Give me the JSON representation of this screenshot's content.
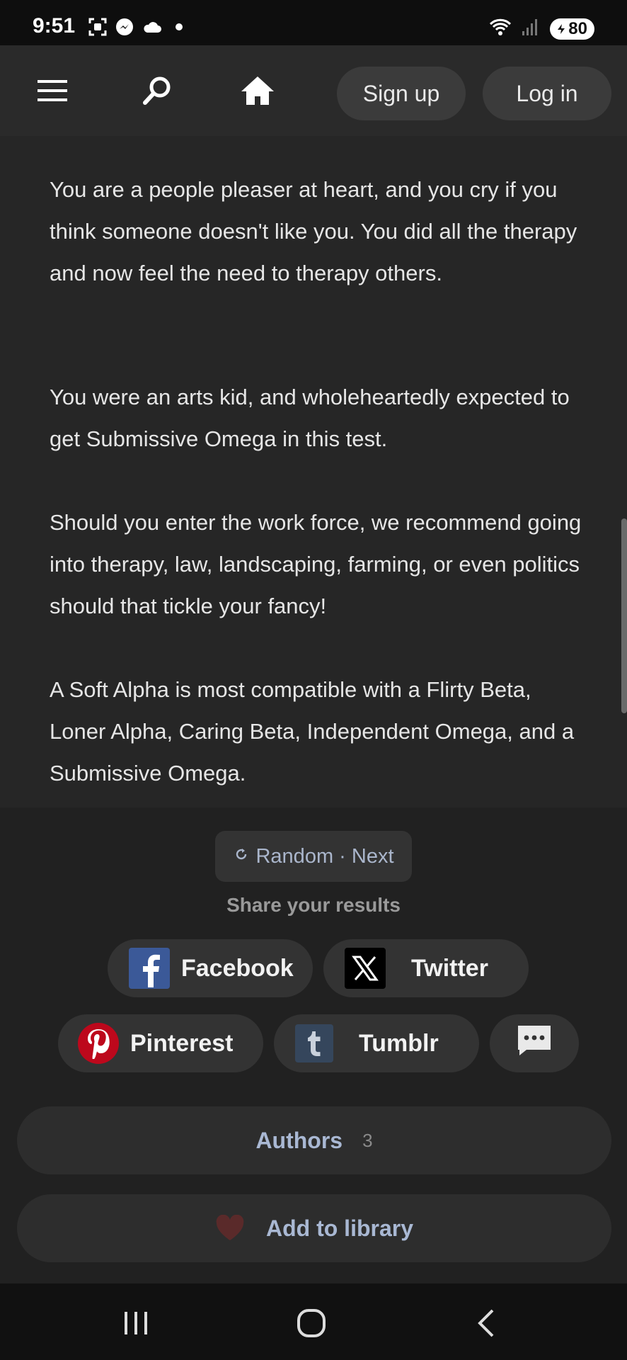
{
  "status_bar": {
    "time": "9:51",
    "battery": "80",
    "icons": [
      "screenshot-icon",
      "messenger-icon",
      "cloud-icon",
      "dot-icon",
      "wifi-icon",
      "signal-icon",
      "battery-icon"
    ]
  },
  "nav": {
    "signup_label": "Sign up",
    "login_label": "Log in",
    "icons": [
      "menu-icon",
      "search-icon",
      "home-icon"
    ]
  },
  "content": {
    "paragraphs": [
      "You are a people pleaser at heart, and you cry if you think someone doesn't like you. You did all the therapy and now feel the need to therapy others.",
      "You were an arts kid, and wholeheartedly expected to get Submissive Omega in this test.",
      "Should you enter the work force, we recommend going into therapy, law, landscaping, farming, or even politics should that tickle your fancy!",
      "A Soft Alpha is most compatible with a Flirty Beta, Loner Alpha, Caring Beta, Independent Omega, and a Submissive Omega."
    ]
  },
  "actions": {
    "random_label": "Random · Next",
    "share_title": "Share your results",
    "share": {
      "facebook": "Facebook",
      "twitter": "Twitter",
      "pinterest": "Pinterest",
      "tumblr": "Tumblr"
    },
    "authors_label": "Authors",
    "authors_count": "3",
    "library_label": "Add to library"
  },
  "colors": {
    "accent_link": "#aab6cc",
    "facebook": "#3b5998",
    "pinterest": "#bd081c",
    "tumblr": "#35465c",
    "heart": "#5a2a2a"
  }
}
